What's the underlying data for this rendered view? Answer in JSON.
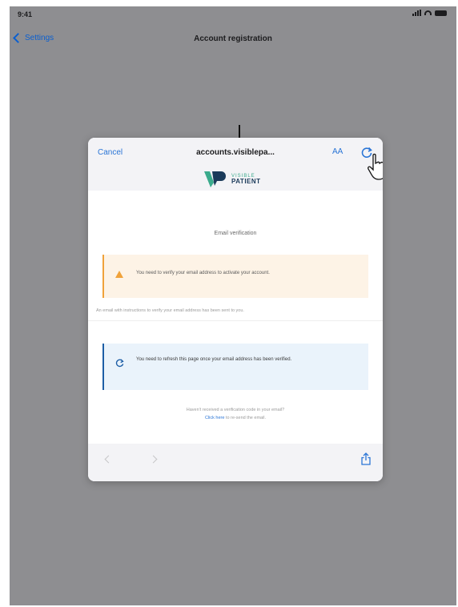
{
  "status": {
    "time": "9:41"
  },
  "nav": {
    "back_label": "Settings",
    "title": "Account registration"
  },
  "sheet": {
    "cancel_label": "Cancel",
    "url": "accounts.visiblepa...",
    "text_size_label": "AA",
    "logo": {
      "line1": "VISIBLE",
      "line2": "PATIENT"
    },
    "page_title": "Email verification",
    "warning_text": "You need to verify your email address to activate your account.",
    "info_line": "An email with instructions to verify your email address has been sent to you.",
    "refresh_text": "You need to refresh this page once your email address has been verified.",
    "footer_question": "Haven't received a verification code in your email?",
    "click_here": "Click here",
    "footer_rest": " to re-send the email."
  },
  "icons": {
    "back": "chevron-left-icon",
    "reload": "reload-icon",
    "warning": "warning-icon",
    "refresh": "refresh-icon",
    "share": "share-icon",
    "pointer": "hand-pointer-icon"
  },
  "colors": {
    "overlay": "#8e8e91",
    "ios_blue": "#0a5fd0",
    "warning_bg": "#fdf3e6",
    "warning_accent": "#f0a23a",
    "info_bg": "#eaf3fb",
    "info_accent": "#1d5ea6",
    "logo_green": "#3aaa8c",
    "logo_navy": "#1a3a5a"
  }
}
